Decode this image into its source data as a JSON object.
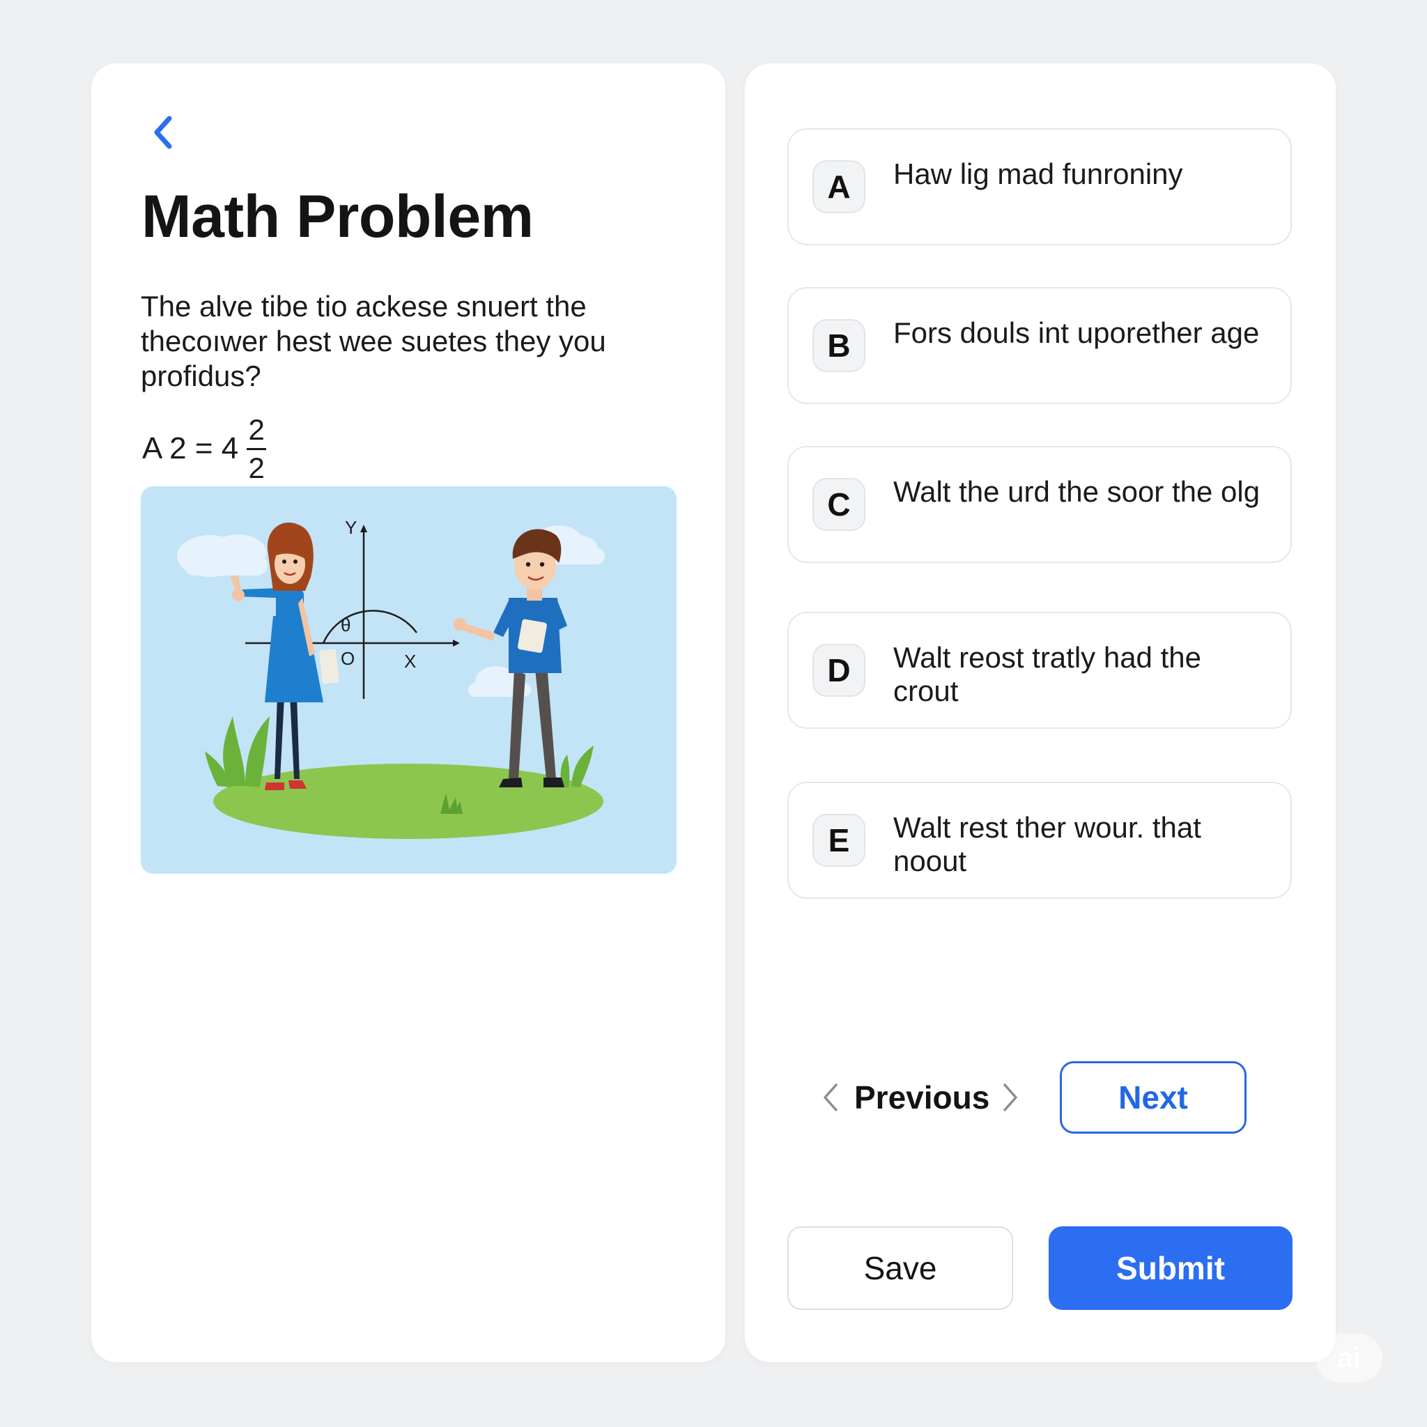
{
  "header": {
    "back_icon": "chevron-left-icon",
    "title": "Math Problem"
  },
  "question": {
    "text": "The alve tibe tio ackese snuert the thecoıwer hest wee suetes they you profidus?",
    "equation": {
      "lhs": "A 2 = 4",
      "fraction_numerator": "2",
      "fraction_denominator": "2"
    },
    "illustration": {
      "axis_y_label": "Y",
      "axis_x_label": "X",
      "origin_label": "O",
      "angle_label": "θ"
    }
  },
  "options": [
    {
      "letter": "A",
      "text": "Haw lig mad funroniny"
    },
    {
      "letter": "B",
      "text": "Fors douls int uporether age"
    },
    {
      "letter": "C",
      "text": "Walt the urd the soor the olg"
    },
    {
      "letter": "D",
      "text": "Walt reost tratly had the crout"
    },
    {
      "letter": "E",
      "text": "Walt rest ther wour. that noout"
    }
  ],
  "navigation": {
    "previous_label": "Previous",
    "next_label": "Next"
  },
  "actions": {
    "save_label": "Save",
    "submit_label": "Submit"
  },
  "watermark": "ai",
  "colors": {
    "accent": "#2b6ef2",
    "background": "#eff0f2",
    "panel": "#ffffff",
    "illustration_sky": "#c3e3f7",
    "grass": "#8cc64f"
  }
}
